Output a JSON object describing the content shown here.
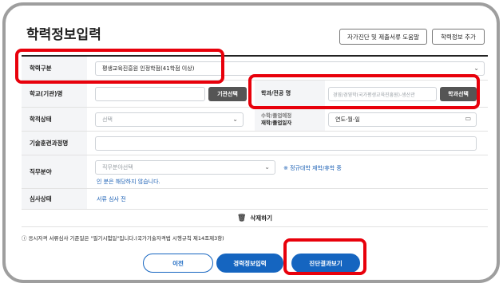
{
  "page": {
    "title": "학력정보입력",
    "help_button": "자가진단 및 제출서류 도움말",
    "add_button": "학력정보 추가"
  },
  "form": {
    "education_type": {
      "label": "학력구분",
      "value": "평생교육진흥원 인정학점(41학점 이상)"
    },
    "school": {
      "label": "학교(기관)명",
      "value": "",
      "button": "기관선택"
    },
    "department": {
      "label": "학과/전공 명",
      "placeholder": "경영/경영학(국가평생교육진흥원)-생산관",
      "button": "학과선택"
    },
    "academic_status": {
      "label": "학적상태",
      "placeholder": "선택"
    },
    "enroll_date": {
      "label": "입학/졸업예정 재학/졸업일자",
      "line1": "수학/졸업예정",
      "line2": "재학/졸업일자",
      "value": "연도-월-일"
    },
    "training": {
      "label": "기술훈련과정명",
      "value": ""
    },
    "job_field": {
      "label": "직무분야",
      "placeholder": "직무분야선택",
      "note": "※ 정규대학 재학/휴학 중",
      "note2": "인 분은 해당하지 않습니다."
    },
    "review_status": {
      "label": "심사상태",
      "value": "서류 심사 전"
    }
  },
  "delete_label": "삭제하기",
  "footnote": "ⓘ 응시자격 서류심사 기준일은 \"필기시험일\"입니다.(국가기술자격법 시행규칙 제14조제3항)",
  "buttons": {
    "prev": "이전",
    "save": "경력정보입력",
    "diagnosis": "진단결과보기"
  },
  "colors": {
    "highlight": "#e8000b",
    "primary": "#1565c0",
    "dark_button": "#555555"
  }
}
